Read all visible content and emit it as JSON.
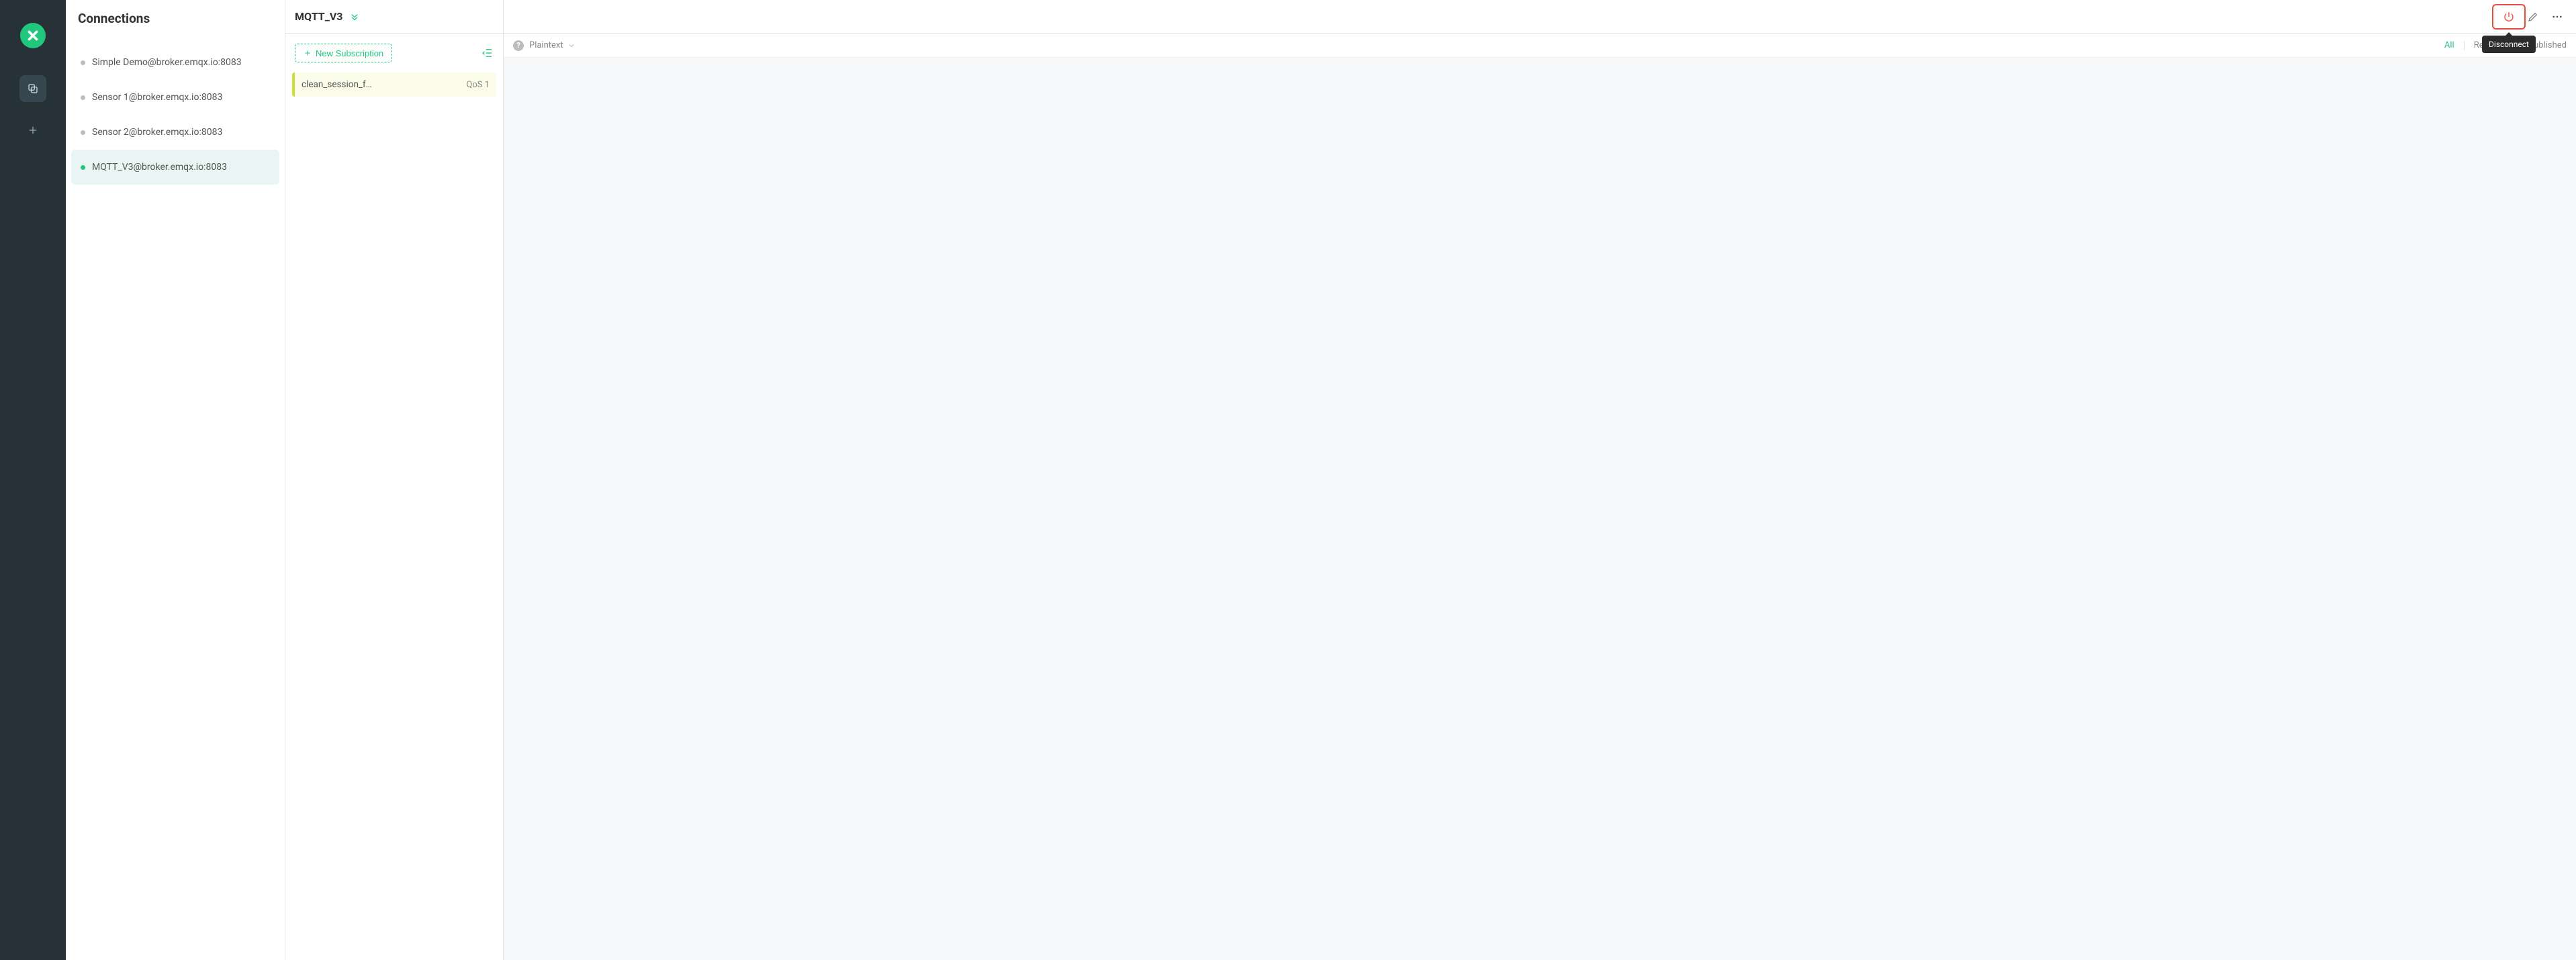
{
  "sidebar": {
    "title": "Connections",
    "items": [
      {
        "label": "Simple Demo@broker.emqx.io:8083",
        "active": false
      },
      {
        "label": "Sensor 1@broker.emqx.io:8083",
        "active": false
      },
      {
        "label": "Sensor 2@broker.emqx.io:8083",
        "active": false
      },
      {
        "label": "MQTT_V3@broker.emqx.io:8083",
        "active": true
      }
    ]
  },
  "connection": {
    "name": "MQTT_V3",
    "new_subscription_label": "New Subscription",
    "subscriptions": [
      {
        "topic": "clean_session_f…",
        "qos": "QoS 1"
      }
    ]
  },
  "toolbar": {
    "disconnect_tooltip": "Disconnect"
  },
  "filter": {
    "format": "Plaintext",
    "tabs": {
      "all": "All",
      "received": "Received",
      "published": "Published"
    }
  }
}
